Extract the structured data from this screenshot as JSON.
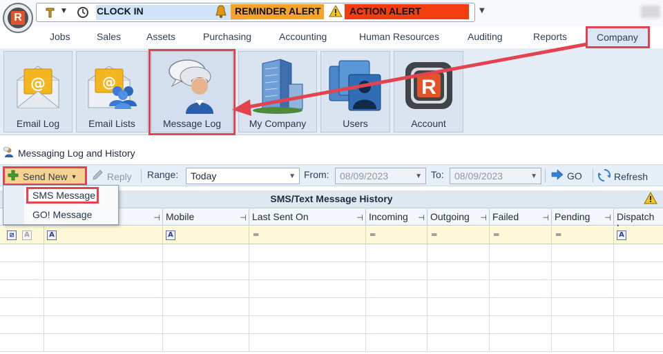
{
  "topbar": {
    "clock_label": "CLOCK IN",
    "reminder_label": "REMINDER ALERT",
    "action_label": "ACTION ALERT",
    "colors": {
      "clock_bg": "#cfe4f9",
      "reminder_bg": "#f7a32a",
      "action_bg": "#f23d10"
    }
  },
  "menu": {
    "items": [
      "Jobs",
      "Sales",
      "Assets",
      "Purchasing",
      "Accounting",
      "Human Resources",
      "Auditing",
      "Reports",
      "Company"
    ],
    "active": "Company"
  },
  "ribbon": {
    "buttons": [
      {
        "label": "Email Log",
        "icon": "email-log-icon"
      },
      {
        "label": "Email Lists",
        "icon": "email-lists-icon"
      },
      {
        "label": "Message Log",
        "icon": "message-log-icon"
      },
      {
        "label": "My Company",
        "icon": "company-building-icon"
      },
      {
        "label": "Users",
        "icon": "users-icon"
      },
      {
        "label": "Account",
        "icon": "account-logo-icon"
      }
    ]
  },
  "section": {
    "title": "Messaging Log and History"
  },
  "toolbar": {
    "send_new": "Send New",
    "reply": "Reply",
    "range_label": "Range:",
    "range_value": "Today",
    "from_label": "From:",
    "from_value": "08/09/2023",
    "to_label": "To:",
    "to_value": "08/09/2023",
    "go": "GO",
    "refresh": "Refresh"
  },
  "send_menu": {
    "items": [
      "SMS Message",
      "GO! Message"
    ]
  },
  "grid": {
    "title": "SMS/Text Message History",
    "columns": [
      "Mobile",
      "Last Sent On",
      "Incoming",
      "Outgoing",
      "Failed",
      "Pending",
      "Dispatch L"
    ]
  }
}
